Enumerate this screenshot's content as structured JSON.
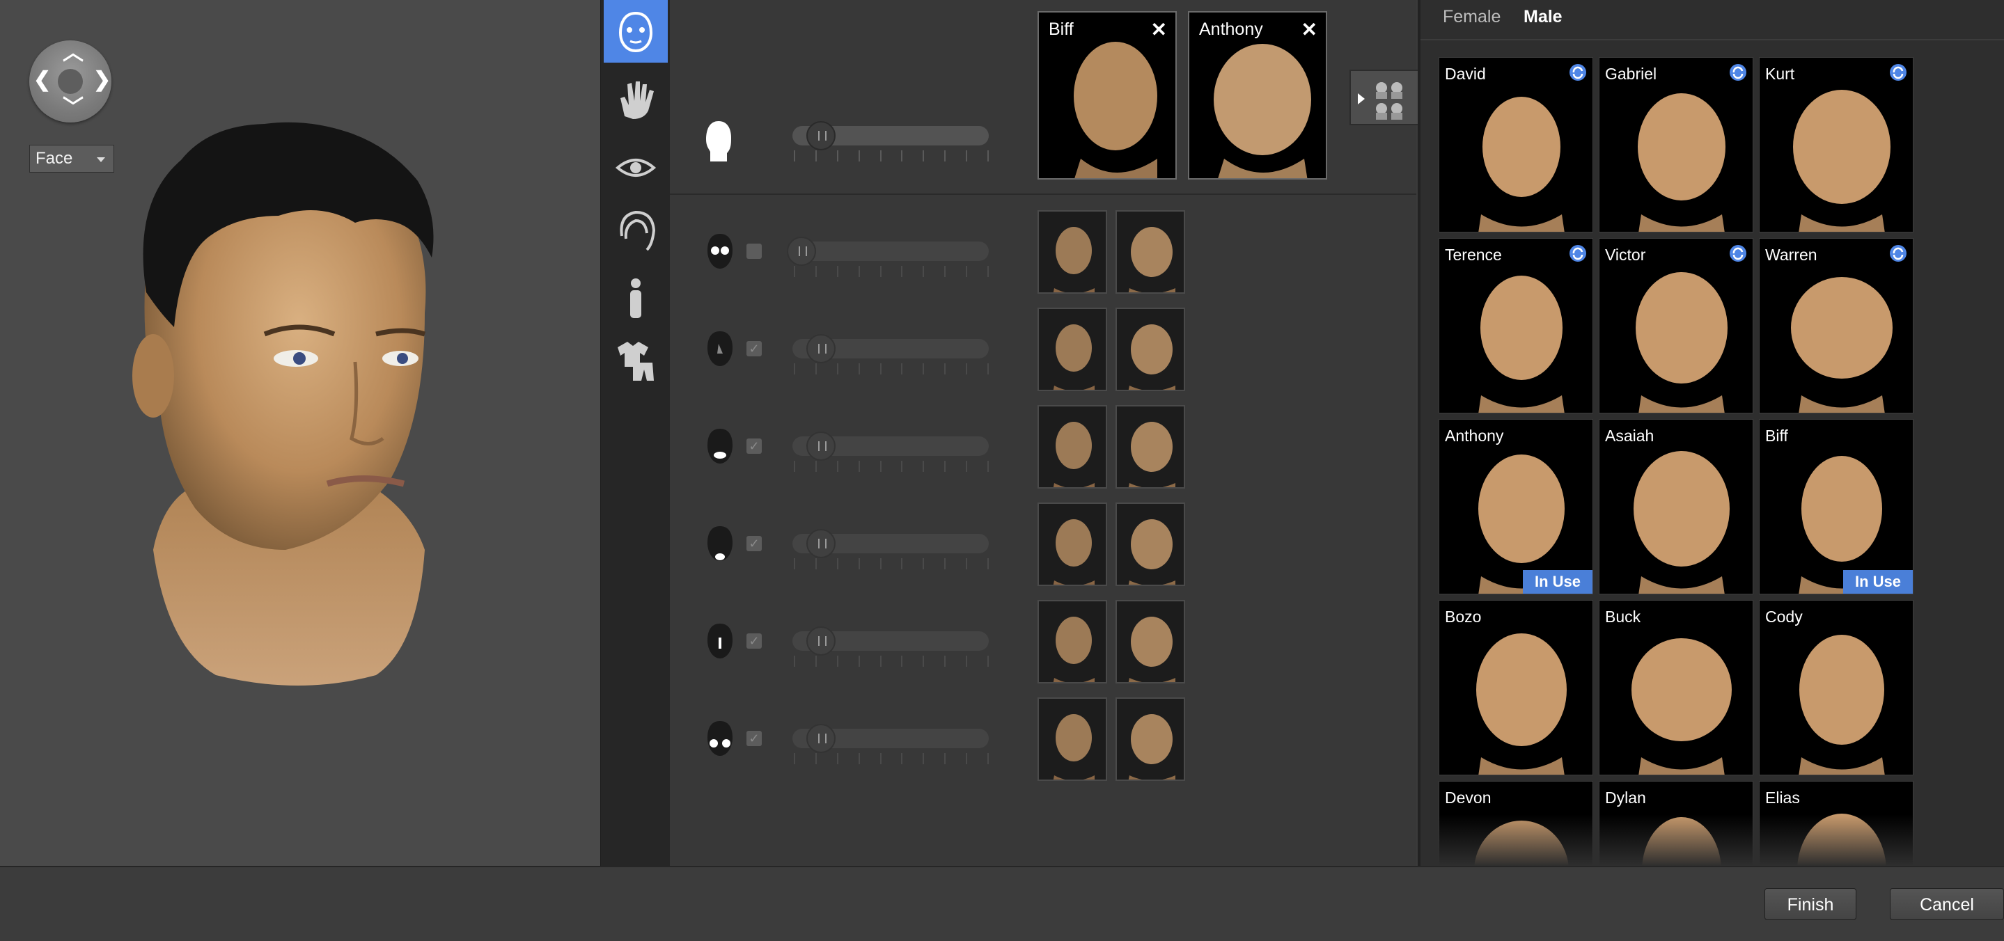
{
  "viewport": {
    "view_select": "Face",
    "nav_icon": "orbit-navigation-icon"
  },
  "categories": [
    {
      "icon": "head-icon",
      "active": true
    },
    {
      "icon": "hand-icon",
      "active": false
    },
    {
      "icon": "eye-icon",
      "active": false
    },
    {
      "icon": "hair-icon",
      "active": false
    },
    {
      "icon": "body-icon",
      "active": false
    },
    {
      "icon": "clothing-icon",
      "active": false
    }
  ],
  "morph": {
    "blend_sources": [
      {
        "name": "Biff",
        "close": "✕"
      },
      {
        "name": "Anthony",
        "close": "✕"
      }
    ],
    "master_slider": 0.1,
    "rows": [
      {
        "region": "eyes-region-icon",
        "checked": false,
        "value": 0.0
      },
      {
        "region": "nose-region-icon",
        "checked": true,
        "value": 0.1
      },
      {
        "region": "mouth-region-icon",
        "checked": true,
        "value": 0.1
      },
      {
        "region": "chin-region-icon",
        "checked": true,
        "value": 0.1
      },
      {
        "region": "forehead-region-icon",
        "checked": true,
        "value": 0.1
      },
      {
        "region": "cheeks-region-icon",
        "checked": true,
        "value": 0.1
      }
    ]
  },
  "presets": {
    "tabs": [
      {
        "label": "Female",
        "active": false
      },
      {
        "label": "Male",
        "active": true
      }
    ],
    "faces": [
      {
        "name": "David",
        "sync": true,
        "badge": ""
      },
      {
        "name": "Gabriel",
        "sync": true,
        "badge": ""
      },
      {
        "name": "Kurt",
        "sync": true,
        "badge": ""
      },
      {
        "name": "Terence",
        "sync": true,
        "badge": ""
      },
      {
        "name": "Victor",
        "sync": true,
        "badge": ""
      },
      {
        "name": "Warren",
        "sync": true,
        "badge": ""
      },
      {
        "name": "Anthony",
        "sync": false,
        "badge": "In Use"
      },
      {
        "name": "Asaiah",
        "sync": false,
        "badge": ""
      },
      {
        "name": "Biff",
        "sync": false,
        "badge": "In Use"
      },
      {
        "name": "Bozo",
        "sync": false,
        "badge": ""
      },
      {
        "name": "Buck",
        "sync": false,
        "badge": ""
      },
      {
        "name": "Cody",
        "sync": false,
        "badge": ""
      },
      {
        "name": "Devon",
        "sync": false,
        "badge": ""
      },
      {
        "name": "Dylan",
        "sync": false,
        "badge": ""
      },
      {
        "name": "Elias",
        "sync": false,
        "badge": ""
      }
    ]
  },
  "footer": {
    "finish_label": "Finish",
    "cancel_label": "Cancel"
  },
  "colors": {
    "accent": "#4f86e6",
    "badge": "#4a7fd8",
    "skin": "#c89a6c"
  }
}
